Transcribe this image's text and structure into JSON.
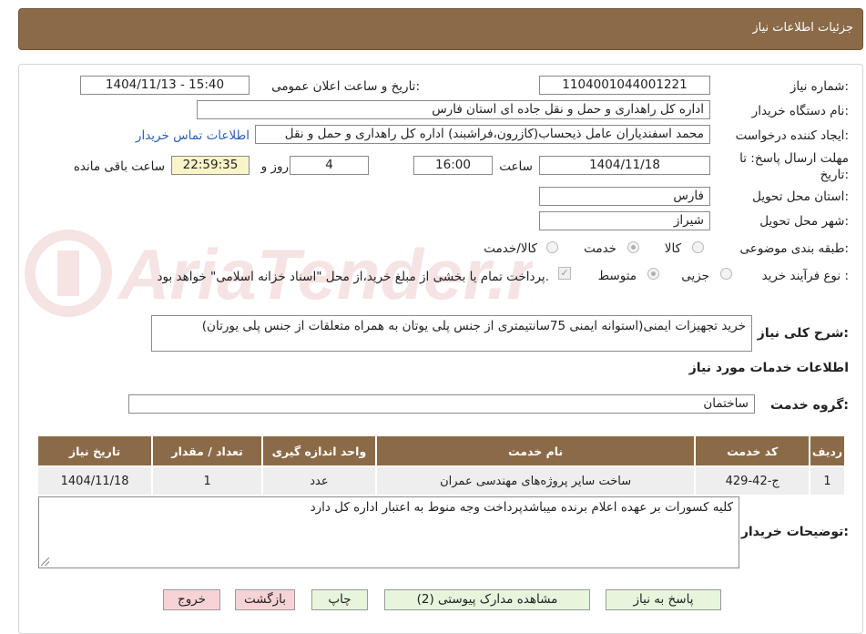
{
  "header": {
    "title": "جزئیات اطلاعات نیاز"
  },
  "form": {
    "need_number_label": "شماره نیاز:",
    "need_number": "1104001044001221",
    "announce_label": "تاریخ و ساعت اعلان عمومی:",
    "announce_value": "1404/11/13 - 15:40",
    "buyer_org_label": "نام دستگاه خریدار:",
    "buyer_org": "اداره کل راهداری و حمل و نقل جاده ای استان فارس",
    "requester_label": "ایجاد کننده درخواست:",
    "requester": "محمد اسفندیاران عامل ذیحساب(کازرون،فراشبند) اداره کل راهداری و حمل و نقل",
    "contact_link": "اطلاعات تماس خریدار",
    "deadline_label_line1": "مهلت ارسال پاسخ: تا",
    "deadline_label_line2": "تاریخ:",
    "deadline_date": "1404/11/18",
    "time_label": "ساعت",
    "deadline_time": "16:00",
    "days_value": "4",
    "days_label": "روز و",
    "remaining_time": "22:59:35",
    "remaining_label": "ساعت باقی مانده",
    "province_label": "استان محل تحویل:",
    "province": "فارس",
    "city_label": "شهر محل تحویل:",
    "city": "شیراز",
    "category_label": "طبقه بندی موضوعی:",
    "category_options": [
      "کالا",
      "خدمت",
      "کالا/خدمت"
    ],
    "category_selected": "خدمت",
    "process_label": "نوع فرآیند خرید :",
    "process_options": [
      "جزیی",
      "متوسط"
    ],
    "process_selected": "متوسط",
    "payment_note": "پرداخت تمام یا بخشی از مبلغ خرید،از محل \"اسناد خزانه اسلامی\" خواهد بود."
  },
  "summary": {
    "label": "شرح کلی نیاز:",
    "text": "خرید تجهیزات ایمنی(استوانه ایمنی 75سانتیمتری از جنس پلی یوتان به همراه متعلقات از جنس پلی یورتان)"
  },
  "services": {
    "section_title": "اطلاعات خدمات مورد نیاز",
    "group_label": "گروه خدمت:",
    "group_value": "ساختمان"
  },
  "table": {
    "headers": [
      "ردیف",
      "کد خدمت",
      "نام خدمت",
      "واحد اندازه گیری",
      "تعداد / مقدار",
      "تاریخ نیاز"
    ],
    "rows": [
      [
        "1",
        "ج-42-429",
        "ساخت سایر پروژه‌های مهندسی عمران",
        "عدد",
        "1",
        "1404/11/18"
      ]
    ]
  },
  "buyer_notes": {
    "label": "توضیحات خریدار:",
    "text": "کلیه کسورات بر عهده اعلام برنده میباشدپرداخت وجه منوط به اعتبار اداره کل دارد"
  },
  "buttons": {
    "reply": "پاسخ به نیاز",
    "attachments": "مشاهده مدارک پیوستی (2)",
    "print": "چاپ",
    "back": "بازگشت",
    "exit": "خروج"
  },
  "colors": {
    "header_brown": "#8b6a47",
    "button_green": "#e6f5dc",
    "button_pink": "#f8d3d6",
    "remaining_yellow": "#fbf4c9"
  }
}
